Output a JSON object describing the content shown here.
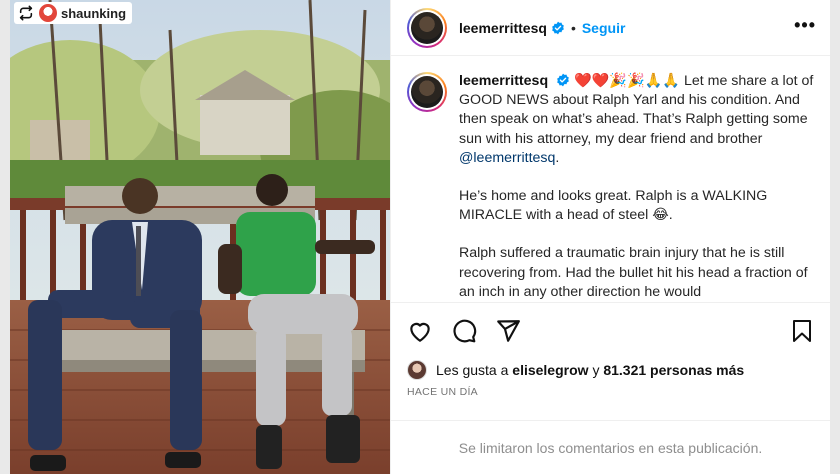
{
  "repost": {
    "icon": "repost-icon",
    "avatar": "shaunking-avatar",
    "username": "shaunking"
  },
  "post": {
    "author": "leemerrittesq",
    "verified_icon": "verified-badge-icon",
    "separator": "•",
    "follow_label": "Seguir",
    "more_label": "•••",
    "caption": {
      "author": "leemerrittesq",
      "emojis": "❤️❤️🎉🎉🙏🙏",
      "paragraph1": "Let me share a lot of GOOD NEWS about Ralph Yarl and his condition. And then speak on what’s ahead. That’s Ralph getting some sun with his attorney, my dear friend and brother ",
      "mention": "@leemerrittesq",
      "period": ".",
      "paragraph2": "He’s home and looks great. Ralph is a WALKING MIRACLE with a head of steel 😂.",
      "paragraph3": "Ralph suffered a traumatic brain injury that he is still recovering from. Had the bullet hit his head a fraction of an inch in any other direction he would"
    },
    "actions": {
      "like_icon": "heart-icon",
      "comment_icon": "comment-icon",
      "share_icon": "share-icon",
      "save_icon": "bookmark-icon"
    },
    "likes": {
      "prefix": "Les gusta a",
      "user": "eliselegrow",
      "joiner": "y",
      "count": "81.321 personas más"
    },
    "timestamp": "HACE UN DÍA",
    "comments_notice": "Se limitaron los comentarios en esta publicación."
  },
  "colors": {
    "link_blue": "#0095f6",
    "mention_blue": "#00376b",
    "muted_gray": "#737373",
    "border": "#efefef"
  }
}
